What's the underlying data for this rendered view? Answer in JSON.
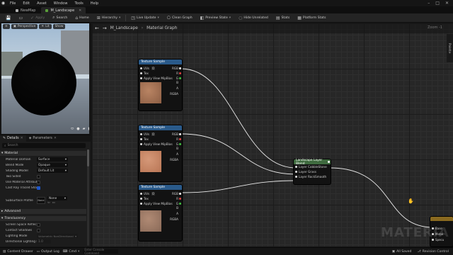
{
  "menu": {
    "items": [
      "File",
      "Edit",
      "Asset",
      "Window",
      "Tools",
      "Help"
    ]
  },
  "doc_tabs": [
    {
      "label": "NewMap",
      "active": false,
      "color": "#b0b0b0"
    },
    {
      "label": "M_Landscape",
      "active": true,
      "color": "#5a9e3a"
    }
  ],
  "toolbar": {
    "apply": "Apply",
    "search": "Search",
    "home": "Home",
    "hierarchy": "Hierarchy",
    "live_update": "Live Update",
    "clean_graph": "Clean Graph",
    "preview_state": "Preview State",
    "hide_unrelated": "Hide Unrelated",
    "stats": "Stats",
    "platform_stats": "Platform Stats"
  },
  "viewport": {
    "buttons": [
      "Perspective",
      "Lit",
      "Show"
    ]
  },
  "details": {
    "tabs": [
      "Details",
      "Parameters"
    ],
    "search_placeholder": "Search",
    "sections": {
      "material": "Material",
      "advanced": "Advanced",
      "translucency": "Translucency"
    },
    "props": [
      {
        "label": "Material Domain",
        "value": "Surface",
        "kind": "select"
      },
      {
        "label": "Blend Mode",
        "value": "Opaque",
        "kind": "select"
      },
      {
        "label": "Shading Model",
        "value": "Default Lit",
        "kind": "select"
      },
      {
        "label": "Two Sided",
        "value": "",
        "kind": "check",
        "on": false
      },
      {
        "label": "Use Material Attributes",
        "value": "",
        "kind": "check",
        "on": false
      },
      {
        "label": "Cast Ray Traced Shad...",
        "value": "",
        "kind": "check",
        "on": true
      },
      {
        "label": "Subsurface Profile",
        "value": "None",
        "kind": "select"
      }
    ],
    "translucency_props": [
      {
        "label": "Screen Space Reflecti...",
        "value": "",
        "kind": "check",
        "on": false
      },
      {
        "label": "Contact Shadows",
        "value": "",
        "kind": "check",
        "on": false
      },
      {
        "label": "Lighting Mode",
        "value": "Volumetric NonDirectional",
        "kind": "select"
      },
      {
        "label": "Directional Lighting In...",
        "value": "1.0",
        "kind": "number"
      }
    ]
  },
  "graph": {
    "breadcrumb_root": "M_Landscape",
    "breadcrumb_leaf": "Material Graph",
    "zoom": "Zoom -1",
    "palette": "Palette",
    "watermark": "MATERIA",
    "texture_node": {
      "title": "Texture Sample",
      "inputs": [
        {
          "label": "UVs",
          "value": "0"
        },
        {
          "label": "Tex"
        },
        {
          "label": "Apply View MipBias"
        }
      ],
      "outputs": [
        "RGB",
        "R",
        "G",
        "B",
        "A",
        "RGBA"
      ],
      "output_colors": [
        "#ffffff",
        "#e04040",
        "#40c040",
        "#4060e0",
        "#c0c0c0",
        "#ffffff"
      ]
    },
    "blend_node": {
      "title": "Landscape Layer Blend",
      "layers": [
        "Layer CobbleStone",
        "Layer Grass",
        "Layer RockSmooth"
      ]
    },
    "material_node": {
      "pins": [
        "Base",
        "Metal",
        "Specu"
      ]
    }
  },
  "bottom": {
    "content_drawer": "Content Drawer",
    "output_log": "Output Log",
    "cmd": "Cmd",
    "cmd_placeholder": "Enter Console Command",
    "all_saved": "All Saved",
    "revision_control": "Revision Control"
  },
  "colors": {
    "node_header": "#2a5a8a",
    "blend_header": "#3f6b3f",
    "accent": "#1e56c8"
  }
}
